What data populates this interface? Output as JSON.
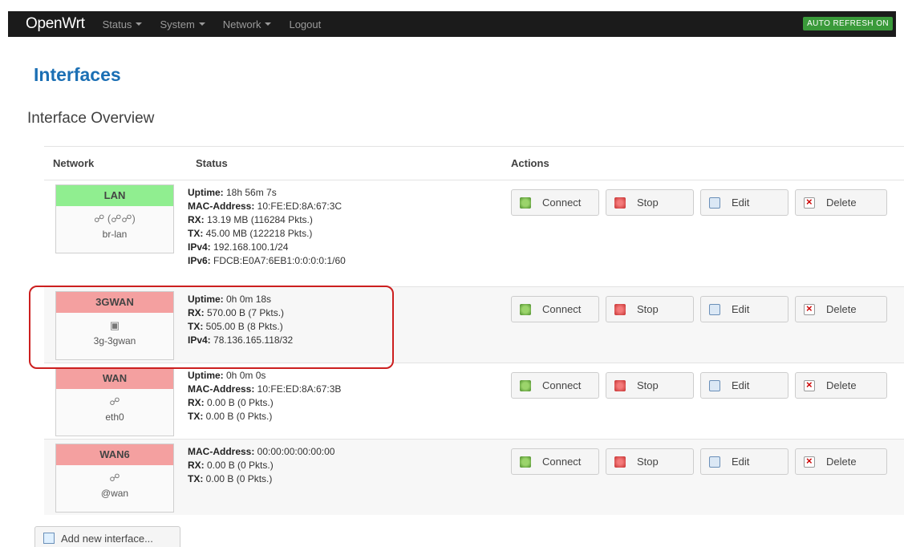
{
  "topbar": {
    "brand": "OpenWrt",
    "menu": [
      "Status",
      "System",
      "Network",
      "Logout"
    ],
    "auto_refresh": "AUTO REFRESH ON"
  },
  "page": {
    "title": "Interfaces",
    "section": "Interface Overview"
  },
  "table": {
    "headers": {
      "network": "Network",
      "status": "Status",
      "actions": "Actions"
    },
    "rows": [
      {
        "name": "LAN",
        "state": "up",
        "icons": "☍ (☍☍)",
        "device": "br-lan",
        "status": [
          {
            "label": "Uptime:",
            "value": " 18h 56m 7s"
          },
          {
            "label": "MAC-Address:",
            "value": " 10:FE:ED:8A:67:3C"
          },
          {
            "label": "RX:",
            "value": " 13.19 MB (116284 Pkts.)"
          },
          {
            "label": "TX:",
            "value": " 45.00 MB (122218 Pkts.)"
          },
          {
            "label": "IPv4:",
            "value": " 192.168.100.1/24"
          },
          {
            "label": "IPv6:",
            "value": " FDCB:E0A7:6EB1:0:0:0:0:1/60"
          }
        ]
      },
      {
        "name": "3GWAN",
        "state": "down",
        "icons": "▣",
        "device": "3g-3gwan",
        "status": [
          {
            "label": "Uptime:",
            "value": " 0h 0m 18s"
          },
          {
            "label": "RX:",
            "value": " 570.00 B (7 Pkts.)"
          },
          {
            "label": "TX:",
            "value": " 505.00 B (8 Pkts.)"
          },
          {
            "label": "IPv4:",
            "value": " 78.136.165.118/32"
          }
        ]
      },
      {
        "name": "WAN",
        "state": "down",
        "icons": "☍",
        "device": "eth0",
        "status": [
          {
            "label": "Uptime:",
            "value": " 0h 0m 0s"
          },
          {
            "label": "MAC-Address:",
            "value": " 10:FE:ED:8A:67:3B"
          },
          {
            "label": "RX:",
            "value": " 0.00 B (0 Pkts.)"
          },
          {
            "label": "TX:",
            "value": " 0.00 B (0 Pkts.)"
          }
        ]
      },
      {
        "name": "WAN6",
        "state": "down",
        "icons": "☍",
        "device": "@wan",
        "status": [
          {
            "label": "MAC-Address:",
            "value": " 00:00:00:00:00:00"
          },
          {
            "label": "RX:",
            "value": " 0.00 B (0 Pkts.)"
          },
          {
            "label": "TX:",
            "value": " 0.00 B (0 Pkts.)"
          }
        ]
      }
    ],
    "buttons": {
      "connect": "Connect",
      "stop": "Stop",
      "edit": "Edit",
      "delete": "Delete"
    }
  },
  "add_button": "Add new interface..."
}
